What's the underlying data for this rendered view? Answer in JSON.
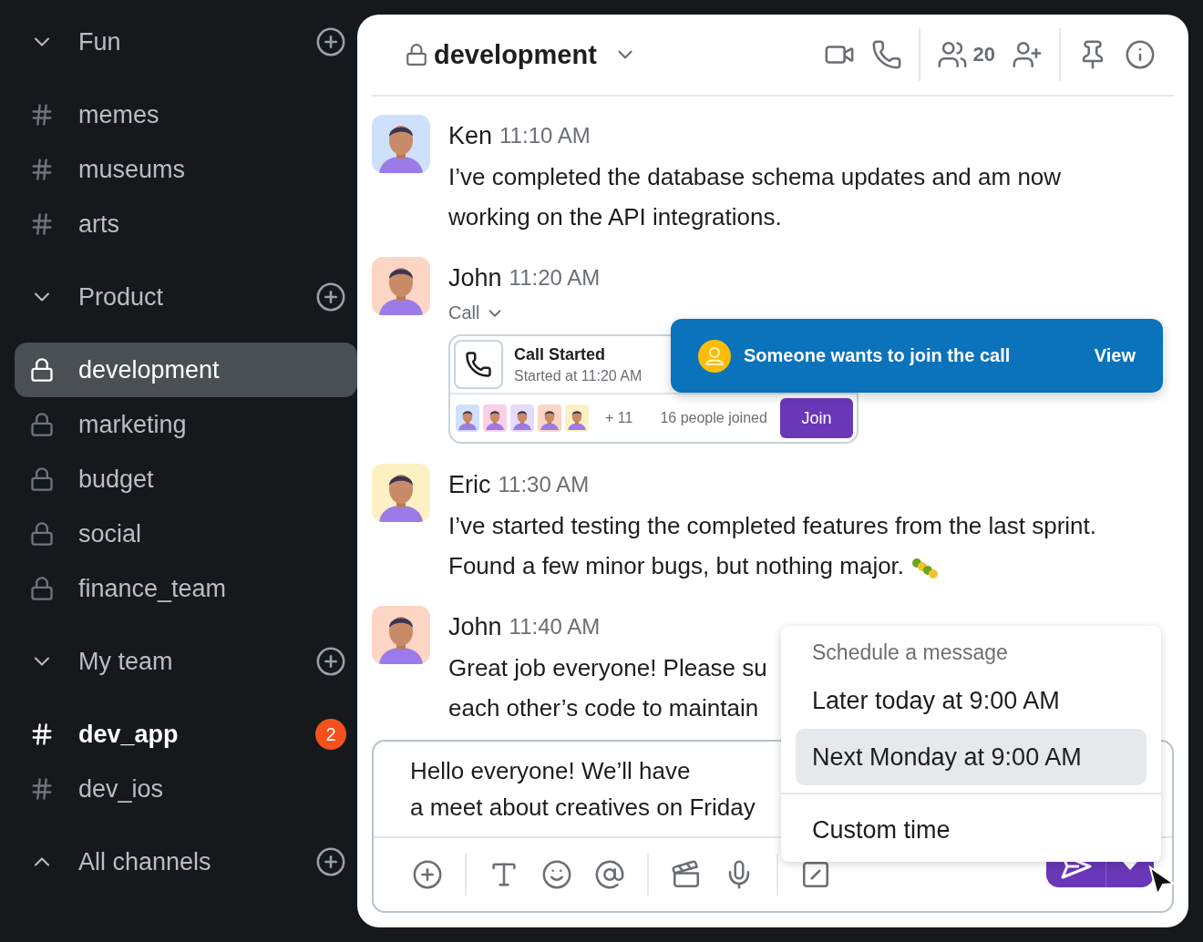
{
  "sidebar": {
    "sections": [
      {
        "title": "Fun",
        "expanded": true,
        "items": [
          {
            "kind": "hash",
            "label": "memes",
            "selected": false,
            "unread": false
          },
          {
            "kind": "hash",
            "label": "museums",
            "selected": false,
            "unread": false
          },
          {
            "kind": "hash",
            "label": "arts",
            "selected": false,
            "unread": false
          }
        ]
      },
      {
        "title": "Product",
        "expanded": true,
        "items": [
          {
            "kind": "lock",
            "label": "development",
            "selected": true,
            "unread": false
          },
          {
            "kind": "lock",
            "label": "marketing",
            "selected": false,
            "unread": false
          },
          {
            "kind": "lock",
            "label": "budget",
            "selected": false,
            "unread": false
          },
          {
            "kind": "lock",
            "label": "social",
            "selected": false,
            "unread": false
          },
          {
            "kind": "lock",
            "label": "finance_team",
            "selected": false,
            "unread": false
          }
        ]
      },
      {
        "title": "My team",
        "expanded": true,
        "items": [
          {
            "kind": "hash",
            "label": "dev_app",
            "selected": false,
            "unread": true,
            "badge": "2"
          },
          {
            "kind": "hash",
            "label": "dev_ios",
            "selected": false,
            "unread": false
          }
        ]
      },
      {
        "title": "All channels",
        "expanded": false
      }
    ]
  },
  "header": {
    "channel": "development",
    "members": "20"
  },
  "messages": [
    {
      "name": "Ken",
      "time": "11:10 AM",
      "text": "I’ve completed the database schema updates and am now working on the API integrations."
    },
    {
      "name": "John",
      "time": "11:20 AM",
      "call": {
        "label": "Call",
        "title": "Call Started",
        "subtitle": "Started at 11:20 AM",
        "more": "+ 11",
        "joined": "16 people joined",
        "button": "Join"
      }
    },
    {
      "name": "Eric",
      "time": "11:30 AM",
      "text": "I’ve started testing the completed features from the last sprint. Found a few minor bugs, but nothing major.",
      "emoji": true
    },
    {
      "name": "John",
      "time": "11:40 AM",
      "text": "Great job everyone! Please su\neach other’s code to maintain"
    }
  ],
  "notification": {
    "text": "Someone wants to join the call",
    "action": "View"
  },
  "schedule_menu": {
    "title": "Schedule a message",
    "options": [
      {
        "label": "Later today at 9:00 AM",
        "selected": false
      },
      {
        "label": "Next Monday at 9:00 AM",
        "selected": true
      },
      {
        "label": "Custom time",
        "selected": false
      }
    ]
  },
  "composer": {
    "text": "Hello everyone! We’ll have\na meet about creatives on Friday"
  }
}
